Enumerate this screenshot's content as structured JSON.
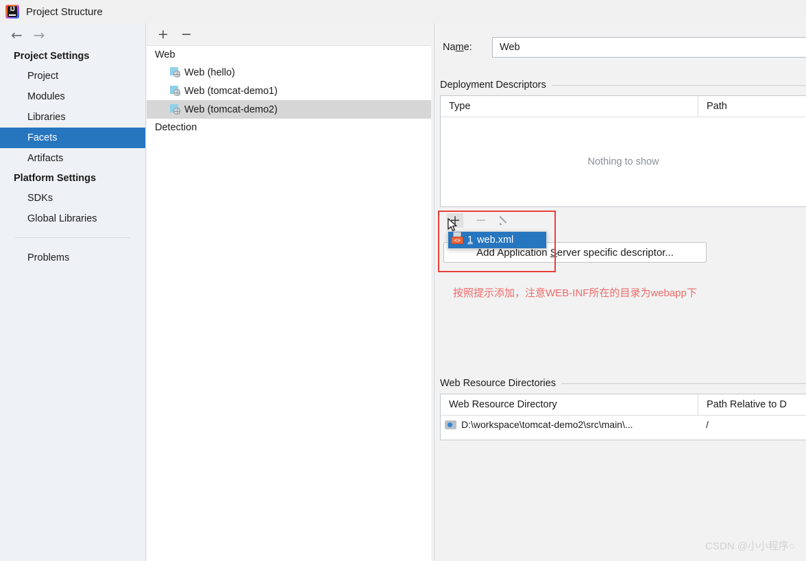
{
  "window": {
    "title": "Project Structure",
    "app_icon": "intellij-idea-icon"
  },
  "sidebar": {
    "nav": {
      "back": "←",
      "forward": "→"
    },
    "sections": [
      {
        "group": "Project Settings",
        "items": [
          {
            "label": "Project",
            "selected": false
          },
          {
            "label": "Modules",
            "selected": false
          },
          {
            "label": "Libraries",
            "selected": false
          },
          {
            "label": "Facets",
            "selected": true
          },
          {
            "label": "Artifacts",
            "selected": false
          }
        ]
      },
      {
        "group": "Platform Settings",
        "items": [
          {
            "label": "SDKs",
            "selected": false
          },
          {
            "label": "Global Libraries",
            "selected": false
          }
        ]
      }
    ],
    "footer_item": "Problems"
  },
  "tree": {
    "toolbar": {
      "add": "+",
      "remove": "−"
    },
    "root": "Web",
    "items": [
      {
        "label": "Web (hello)",
        "selected": false
      },
      {
        "label": "Web (tomcat-demo1)",
        "selected": false
      },
      {
        "label": "Web (tomcat-demo2)",
        "selected": true
      }
    ],
    "second_root": "Detection"
  },
  "details": {
    "name_label_pre": "Na",
    "name_label_mn": "m",
    "name_label_post": "e:",
    "name_value": "Web",
    "deployment": {
      "title": "Deployment Descriptors",
      "columns": [
        "Type",
        "Path"
      ],
      "empty_text": "Nothing to show",
      "toolbar": {
        "add": "+",
        "remove": "−",
        "edit": "edit-pencil-icon"
      },
      "menu": {
        "items": [
          {
            "mnemonic": "1",
            "label": "web.xml",
            "icon": "xml-file-icon",
            "selected": true
          }
        ]
      },
      "add_server_button": {
        "pre": "Add Application ",
        "mn": "S",
        "post": "erver specific descriptor..."
      }
    },
    "web_resources": {
      "title": "Web Resource Directories",
      "columns": [
        "Web Resource Directory",
        "Path Relative to D"
      ],
      "rows": [
        {
          "directory": "D:\\workspace\\tomcat-demo2\\src\\main\\...",
          "relative": "/"
        }
      ]
    }
  },
  "annotation": {
    "text": "按照提示添加，注意WEB-INF所在的目录为webapp下",
    "box_color": "#e8403a",
    "text_color": "#ef6a6a"
  },
  "watermark": "CSDN @小小程序○",
  "colors": {
    "selection_blue": "#2675bf",
    "sidebar_bg": "#eef1f5",
    "panel_bg": "#f2f2f2"
  }
}
